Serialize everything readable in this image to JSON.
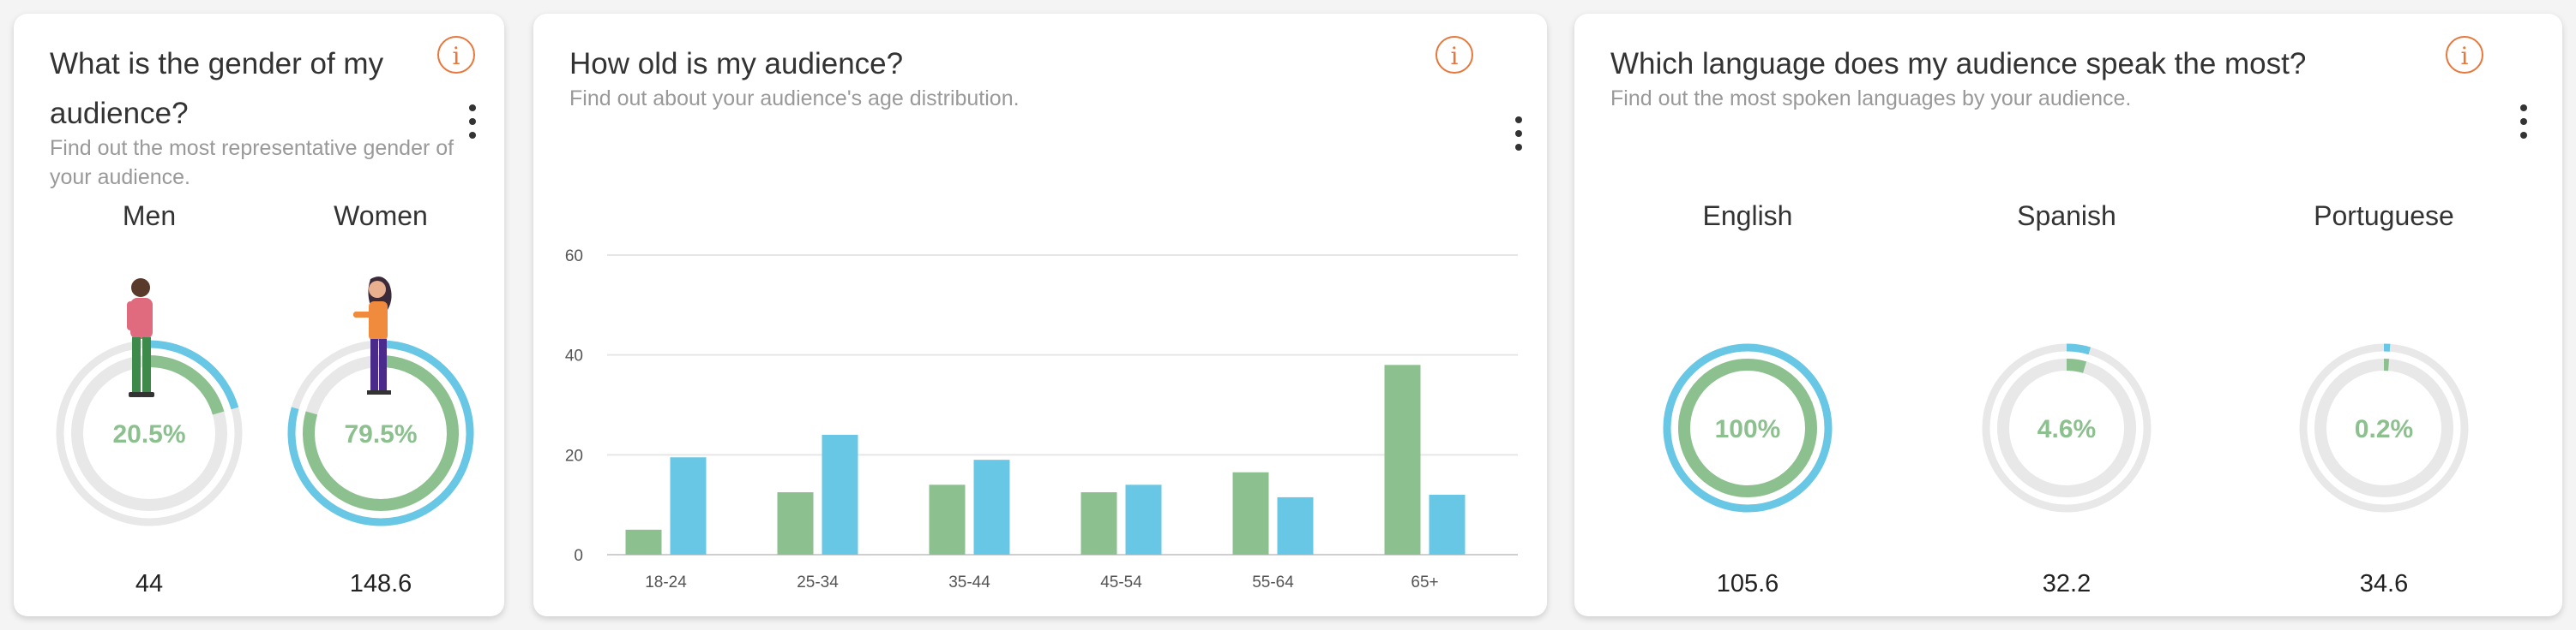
{
  "gender": {
    "title": "What is the gender of my audience?",
    "subtitle": "Find out the most representative gender of your audience.",
    "info_icon": "i",
    "items": [
      {
        "label": "Men",
        "percent_label": "20.5%",
        "percent": 20.5,
        "value": "44"
      },
      {
        "label": "Women",
        "percent_label": "79.5%",
        "percent": 79.5,
        "value": "148.6"
      }
    ]
  },
  "age": {
    "title": "How old is my audience?",
    "subtitle": "Find out about your audience's age distribution.",
    "info_icon": "i"
  },
  "language": {
    "title": "Which language does my audience speak the most?",
    "subtitle": "Find out the most spoken languages by your audience.",
    "info_icon": "i",
    "items": [
      {
        "label": "English",
        "percent_label": "100%",
        "percent": 100,
        "value": "105.6"
      },
      {
        "label": "Spanish",
        "percent_label": "4.6%",
        "percent": 4.6,
        "value": "32.2"
      },
      {
        "label": "Portuguese",
        "percent_label": "0.2%",
        "percent": 0.2,
        "value": "34.6"
      }
    ]
  },
  "colors": {
    "green": "#8cc18f",
    "blue": "#68c7e4",
    "track": "#e8e8e8",
    "accent": "#e8773c"
  },
  "chart_data": {
    "type": "bar",
    "categories": [
      "18-24",
      "25-34",
      "35-44",
      "45-54",
      "55-64",
      "65+"
    ],
    "series": [
      {
        "values": [
          5,
          12.5,
          14,
          12.5,
          16.5,
          38
        ]
      },
      {
        "values": [
          19.5,
          24,
          19,
          14,
          11.5,
          12
        ]
      }
    ],
    "ylim": [
      0,
      60
    ],
    "yticks": [
      "0",
      "20",
      "40",
      "60"
    ],
    "grid": true
  }
}
